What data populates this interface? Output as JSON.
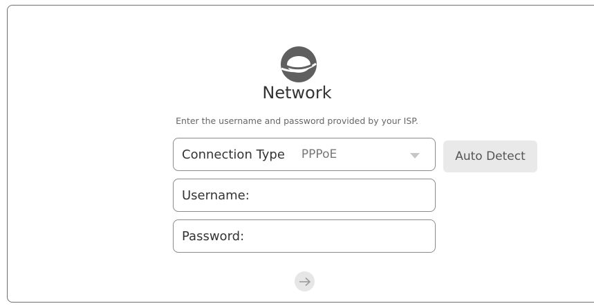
{
  "header": {
    "icon": "globe-icon",
    "title": "Network",
    "subtitle": "Enter the username and password provided by your ISP."
  },
  "form": {
    "connection_type": {
      "label": "Connection Type",
      "value": "PPPoE",
      "icon": "chevron-down-icon"
    },
    "username": {
      "label": "Username:",
      "value": ""
    },
    "password": {
      "label": "Password:",
      "value": ""
    },
    "auto_detect_label": "Auto Detect",
    "next_icon": "arrow-right-icon"
  },
  "colors": {
    "border": "#8a8a8a",
    "globe": "#5f5f5f",
    "button_bg": "#e9e9e9",
    "caret": "#c6c6c6"
  }
}
